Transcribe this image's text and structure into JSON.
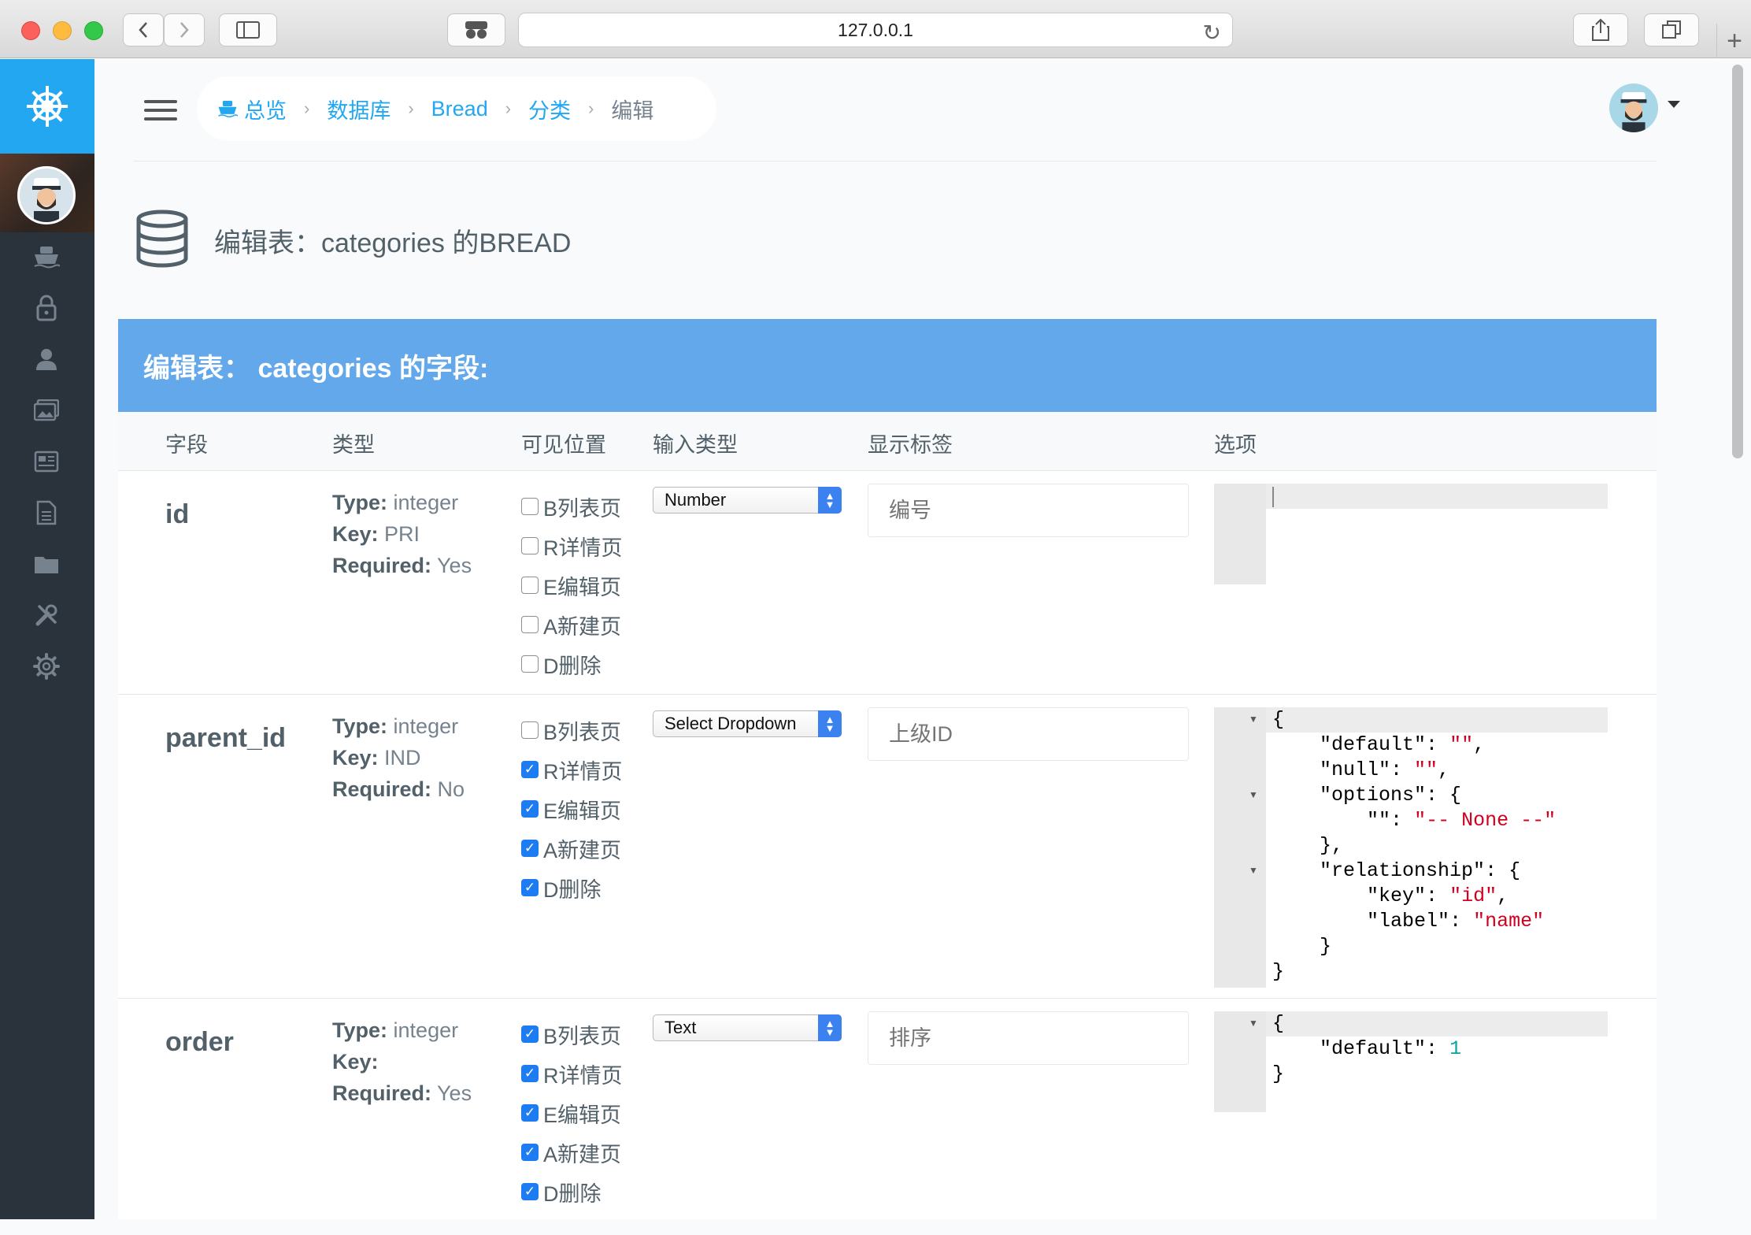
{
  "browser": {
    "url": "127.0.0.1"
  },
  "breadcrumb": [
    {
      "label": "总览"
    },
    {
      "label": "数据库"
    },
    {
      "label": "Bread"
    },
    {
      "label": "分类"
    },
    {
      "label": "编辑"
    }
  ],
  "page": {
    "title": "编辑表：categories 的BREAD"
  },
  "panel": {
    "title": "编辑表： categories 的字段:"
  },
  "table": {
    "headers": [
      "字段",
      "类型",
      "可见位置",
      "输入类型",
      "显示标签",
      "选项"
    ]
  },
  "labels": {
    "type": "Type:",
    "key": "Key:",
    "required": "Required:"
  },
  "visibility_labels": [
    "B列表页",
    "R详情页",
    "E编辑页",
    "A新建页",
    "D删除"
  ],
  "rows": [
    {
      "field": "id",
      "type": "integer",
      "key": "PRI",
      "required": "Yes",
      "checked": [
        false,
        false,
        false,
        false,
        false
      ],
      "input_type": "Number",
      "display_label": "编号",
      "options_lines": []
    },
    {
      "field": "parent_id",
      "type": "integer",
      "key": "IND",
      "required": "No",
      "checked": [
        false,
        true,
        true,
        true,
        true
      ],
      "input_type": "Select Dropdown",
      "display_label": "上级ID",
      "options_lines": []
    },
    {
      "field": "order",
      "type": "integer",
      "key": "",
      "required": "Yes",
      "checked": [
        true,
        true,
        true,
        true,
        true
      ],
      "input_type": "Text",
      "display_label": "排序",
      "options_lines": []
    }
  ],
  "options_json": {
    "parent_id": {
      "default_key": "\"default\"",
      "default_val": "\"\"",
      "null_key": "\"null\"",
      "null_val": "\"\"",
      "options_key": "\"options\"",
      "empty_key": "\"\"",
      "none_val": "\"-- None --\"",
      "relationship_key": "\"relationship\"",
      "key_key": "\"key\"",
      "key_val": "\"id\"",
      "label_key": "\"label\"",
      "label_val": "\"name\""
    },
    "order": {
      "default_key": "\"default\"",
      "default_val": "1"
    }
  },
  "colors": {
    "accent": "#22a7f0",
    "panel_head": "#62a8ea",
    "sidebar": "#2a323c",
    "checkbox": "#1e7cf2"
  }
}
